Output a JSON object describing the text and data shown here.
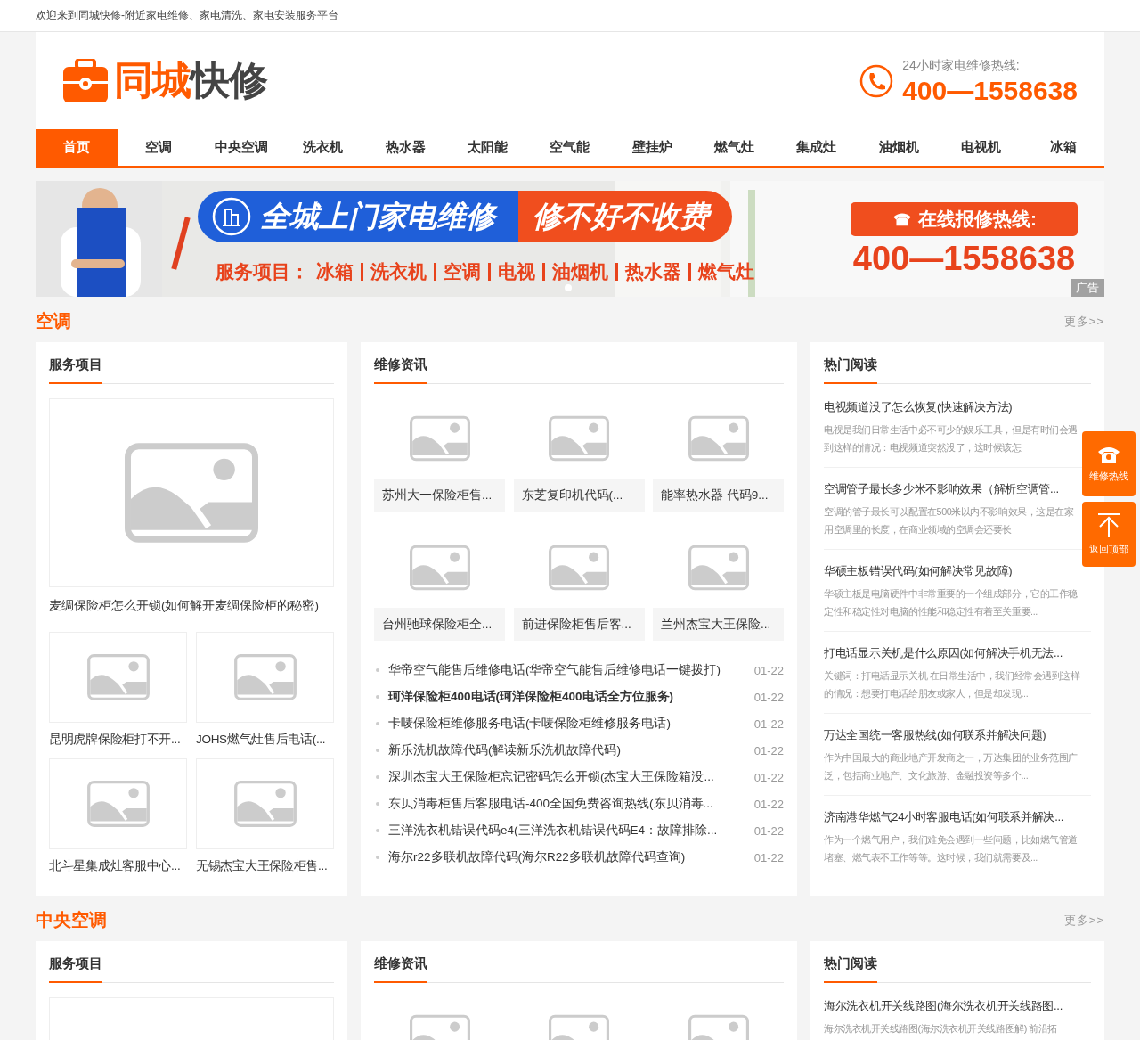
{
  "top_bar": {
    "welcome": "欢迎来到同城快修-附近家电维修、家电清洗、家电安装服务平台"
  },
  "header": {
    "logo_accent": "同城",
    "logo_main": "快修",
    "hotline_label": "24小时家电维修热线:",
    "hotline_number": "400—1558638"
  },
  "nav": [
    {
      "label": "首页",
      "selected": true
    },
    {
      "label": "空调",
      "selected": false
    },
    {
      "label": "中央空调",
      "selected": false
    },
    {
      "label": "洗衣机",
      "selected": false
    },
    {
      "label": "热水器",
      "selected": false
    },
    {
      "label": "太阳能",
      "selected": false
    },
    {
      "label": "空气能",
      "selected": false
    },
    {
      "label": "壁挂炉",
      "selected": false
    },
    {
      "label": "燃气灶",
      "selected": false
    },
    {
      "label": "集成灶",
      "selected": false
    },
    {
      "label": "油烟机",
      "selected": false
    },
    {
      "label": "电视机",
      "selected": false
    },
    {
      "label": "冰箱",
      "selected": false
    }
  ],
  "banner": {
    "headline": "全城上门家电维修",
    "slogan": "修不好不收费",
    "services_label": "服务项目：",
    "services": [
      "冰箱",
      "洗衣机",
      "空调",
      "电视",
      "油烟机",
      "热水器",
      "燃气灶"
    ],
    "hotline_label": "在线报修热线:",
    "hotline_number": "400—1558638",
    "ad_tag": "广告"
  },
  "sections": [
    {
      "title": "空调",
      "more": "更多>>",
      "services": {
        "title": "服务项目",
        "featured": {
          "kind": "placeholder",
          "caption": "麦绸保险柜怎么开锁(如何解开麦绸保险柜的秘密)"
        },
        "items": [
          {
            "caption": "昆明虎牌保险柜打不开..."
          },
          {
            "caption": "JOHS燃气灶售后电话(..."
          },
          {
            "caption": "北斗星集成灶客服中心..."
          },
          {
            "caption": "无锡杰宝大王保险柜售..."
          }
        ]
      },
      "news": {
        "title": "维修资讯",
        "thumbs": [
          {
            "kind": "placeholder",
            "caption": "苏州大一保险柜售..."
          },
          {
            "kind": "placeholder",
            "caption": "东芝复印机代码(..."
          },
          {
            "kind": "placeholder",
            "caption": "能率热水器 代码9..."
          },
          {
            "kind": "placeholder",
            "caption": "台州驰球保险柜全..."
          },
          {
            "kind": "placeholder",
            "caption": "前进保险柜售后客..."
          },
          {
            "kind": "placeholder",
            "caption": "兰州杰宝大王保险..."
          }
        ],
        "list": [
          {
            "title": "华帝空气能售后维修电话(华帝空气能售后维修电话一键拨打)",
            "date": "01-22",
            "highlighted": false
          },
          {
            "title": "珂洋保险柜400电话(珂洋保险柜400电话全方位服务)",
            "date": "01-22",
            "highlighted": true
          },
          {
            "title": "卡唛保险柜维修服务电话(卡唛保险柜维修服务电话)",
            "date": "01-22",
            "highlighted": false
          },
          {
            "title": "新乐洗机故障代码(解读新乐洗机故障代码)",
            "date": "01-22",
            "highlighted": false
          },
          {
            "title": "深圳杰宝大王保险柜忘记密码怎么开锁(杰宝大王保险箱没...",
            "date": "01-22",
            "highlighted": false
          },
          {
            "title": "东贝消毒柜售后客服电话-400全国免费咨询热线(东贝消毒...",
            "date": "01-22",
            "highlighted": false
          },
          {
            "title": "三洋洗衣机错误代码e4(三洋洗衣机错误代码E4：故障排除...",
            "date": "01-22",
            "highlighted": false
          },
          {
            "title": "海尔r22多联机故障代码(海尔R22多联机故障代码查询)",
            "date": "01-22",
            "highlighted": false
          }
        ]
      },
      "hot": {
        "title": "热门阅读",
        "items": [
          {
            "title": "电视频道没了怎么恢复(快速解决方法)",
            "summary": "电视是我们日常生活中必不可少的娱乐工具，但是有时们会遇到这样的情况：电视频道突然没了，这时候该怎"
          },
          {
            "title": "空调管子最长多少米不影响效果（解析空调管...",
            "summary": "空调的管子最长可以配置在500米以内不影响效果，这是在家用空调里的长度，在商业领域的空调会还要长"
          },
          {
            "title": "华硕主板错误代码(如何解决常见故障)",
            "summary": "华硕主板是电脑硬件中非常重要的一个组成部分，它的工作稳定性和稳定性对电脑的性能和稳定性有着至关重要..."
          },
          {
            "title": "打电话显示关机是什么原因(如何解决手机无法...",
            "summary": "关键词：打电话显示关机 在日常生活中，我们经常会遇到这样的情况：想要打电话给朋友或家人，但是却发现..."
          },
          {
            "title": "万达全国统一客服热线(如何联系并解决问题)",
            "summary": "作为中国最大的商业地产开发商之一，万达集团的业务范围广泛，包括商业地产、文化旅游、金融投资等多个..."
          },
          {
            "title": "济南港华燃气24小时客服电话(如何联系并解决...",
            "summary": "作为一个燃气用户，我们难免会遇到一些问题，比如燃气管道堵塞、燃气表不工作等等。这时候，我们就需要及..."
          }
        ]
      }
    },
    {
      "title": "中央空调",
      "more": "更多>>",
      "services": {
        "title": "服务项目",
        "featured": {
          "kind": "placeholder"
        }
      },
      "news": {
        "title": "维修资讯",
        "thumbs": [
          {
            "kind": "placeholder"
          },
          {
            "kind": "placeholder"
          },
          {
            "kind": "placeholder"
          }
        ]
      },
      "hot": {
        "title": "热门阅读",
        "items": [
          {
            "title": "海尔洗衣机开关线路图(海尔洗衣机开关线路图...",
            "summary": "海尔洗衣机开关线路图(海尔洗衣机开关线路图解) 前沿拓"
          }
        ]
      }
    }
  ],
  "side_tools": [
    {
      "kind": "phone",
      "label": "维修热线"
    },
    {
      "kind": "top",
      "label": "返回顶部"
    }
  ]
}
